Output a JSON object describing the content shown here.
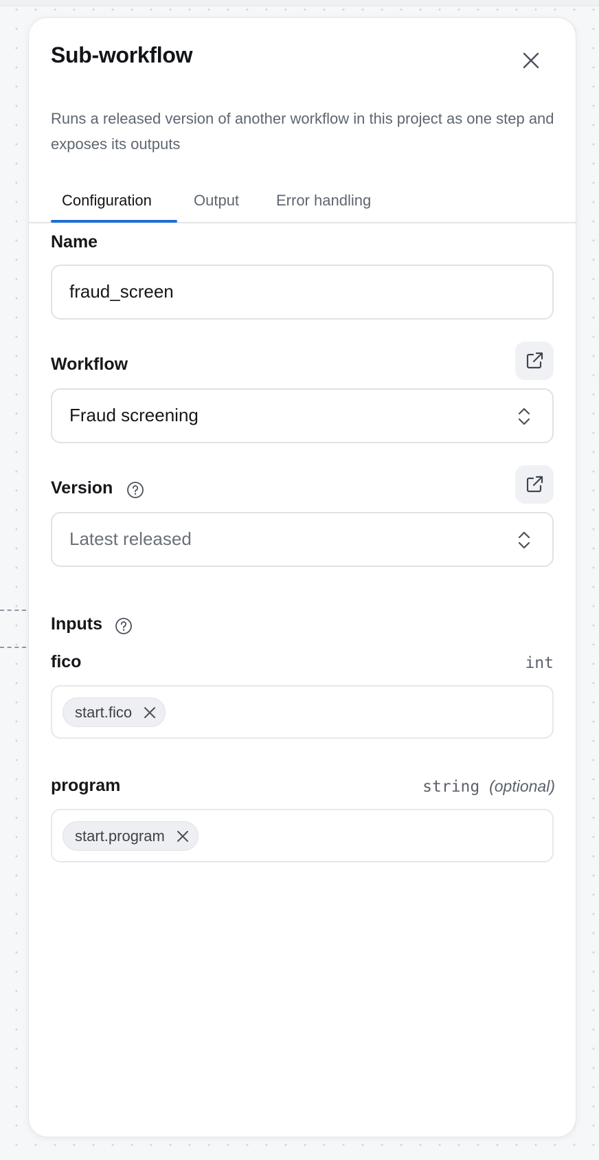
{
  "panel": {
    "title": "Sub-workflow",
    "description": "Runs a released version of another workflow in this project as one step and exposes its outputs",
    "close_icon": "close-icon"
  },
  "tabs": [
    {
      "label": "Configuration",
      "active": true
    },
    {
      "label": "Output",
      "active": false
    },
    {
      "label": "Error handling",
      "active": false
    }
  ],
  "name_field": {
    "label": "Name",
    "value": "fraud_screen"
  },
  "workflow_field": {
    "label": "Workflow",
    "value": "Fraud screening",
    "open_icon": "external-link-icon"
  },
  "version_field": {
    "label": "Version",
    "value": "Latest released",
    "help_icon": "help-circle-icon",
    "open_icon": "external-link-icon"
  },
  "inputs": {
    "label": "Inputs",
    "help_icon": "help-circle-icon",
    "items": [
      {
        "name": "fico",
        "type": "int",
        "optional_label": "",
        "chip": "start.fico"
      },
      {
        "name": "program",
        "type": "string",
        "optional_label": "(optional)",
        "chip": "start.program"
      }
    ]
  },
  "colors": {
    "accent": "#1f6fd6",
    "canvas": "#f6f7f9",
    "panel": "#ffffff"
  }
}
